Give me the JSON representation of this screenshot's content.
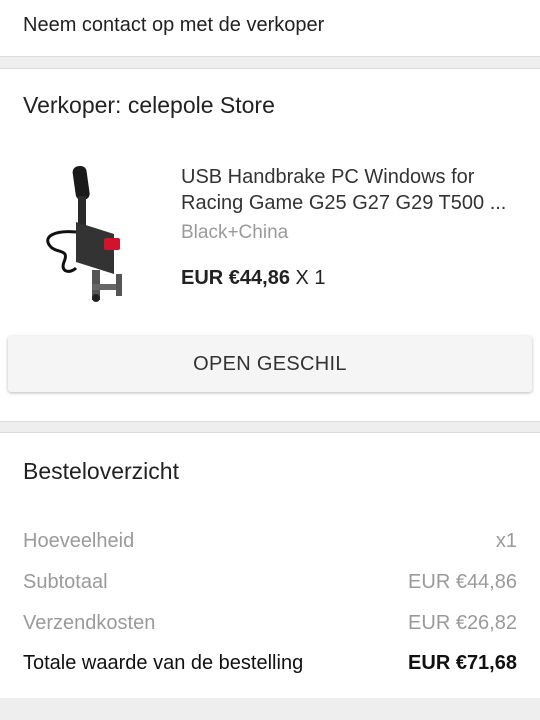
{
  "contact": {
    "label": "Neem contact op met de verkoper"
  },
  "seller": {
    "title": "Verkoper: celepole Store",
    "product": {
      "name_line1": "USB Handbrake PC Windows for",
      "name_line2": "Racing Game G25 G27 G29 T500 ...",
      "variant": "Black+China",
      "price": "EUR €44,86",
      "quantity": "X 1"
    },
    "dispute_button": "OPEN GESCHIL"
  },
  "overview": {
    "title": "Besteloverzicht",
    "rows": [
      {
        "label": "Hoeveelheid",
        "value": "x1"
      },
      {
        "label": "Subtotaal",
        "value": "EUR €44,86"
      },
      {
        "label": "Verzendkosten",
        "value": "EUR €26,82"
      },
      {
        "label": "Totale waarde van de bestelling",
        "value": "EUR €71,68"
      }
    ]
  },
  "colors": {
    "background": "#eeeeee",
    "muted_text": "#9a9a9a",
    "accent_red": "#d0142c"
  }
}
